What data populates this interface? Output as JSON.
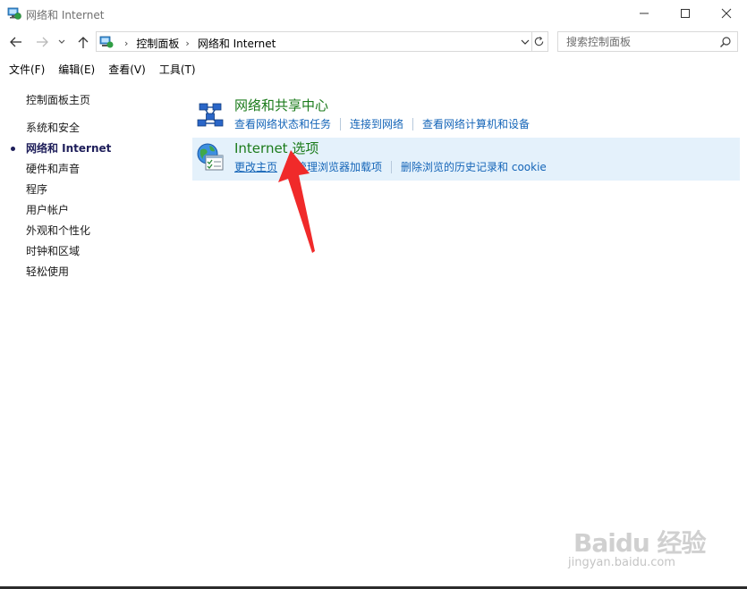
{
  "window": {
    "title": "网络和 Internet",
    "controls": [
      "minimize-icon",
      "maximize-icon",
      "close-icon"
    ]
  },
  "nav": {
    "back_icon": "arrow-left-icon",
    "forward_icon": "arrow-right-icon",
    "recent_icon": "chevron-down-icon",
    "up_icon": "arrow-up-icon",
    "breadcrumbs": [
      "控制面板",
      "网络和 Internet"
    ],
    "refresh_icon": "refresh-icon",
    "search_placeholder": "搜索控制面板"
  },
  "menu": {
    "items": [
      "文件(F)",
      "编辑(E)",
      "查看(V)",
      "工具(T)"
    ]
  },
  "sidebar": {
    "home": "控制面板主页",
    "categories": [
      {
        "label": "系统和安全",
        "active": false
      },
      {
        "label": "网络和 Internet",
        "active": true
      },
      {
        "label": "硬件和声音",
        "active": false
      },
      {
        "label": "程序",
        "active": false
      },
      {
        "label": "用户帐户",
        "active": false
      },
      {
        "label": "外观和个性化",
        "active": false
      },
      {
        "label": "时钟和区域",
        "active": false
      },
      {
        "label": "轻松使用",
        "active": false
      }
    ]
  },
  "main": {
    "sections": [
      {
        "title": "网络和共享中心",
        "icon": "network-sharing-center-icon",
        "links": [
          "查看网络状态和任务",
          "连接到网络",
          "查看网络计算机和设备"
        ]
      },
      {
        "title": "Internet 选项",
        "icon": "internet-options-icon",
        "links": [
          "更改主页",
          "管理浏览器加载项",
          "删除浏览的历史记录和 cookie"
        ]
      }
    ]
  },
  "colors": {
    "category_title": "#1b7b1b",
    "link": "#1565b8",
    "highlight_bg": "#e4f1fb",
    "annotation_arrow": "#f02a2a"
  },
  "watermark": {
    "logo": "Baidu 经验",
    "url": "jingyan.baidu.com"
  }
}
